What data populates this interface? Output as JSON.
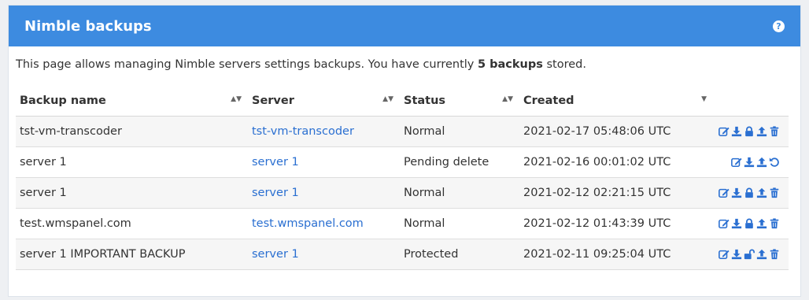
{
  "panel": {
    "title": "Nimble backups",
    "help_glyph": "?"
  },
  "intro": {
    "prefix": "This page allows managing Nimble servers settings backups. You have currently ",
    "count": "5 backups",
    "suffix": " stored."
  },
  "table": {
    "columns": [
      "Backup name",
      "Server",
      "Status",
      "Created"
    ],
    "rows": [
      {
        "name": "tst-vm-transcoder",
        "server": "tst-vm-transcoder",
        "status": "Normal",
        "created": "2021-02-17 05:48:06 UTC",
        "actions": [
          "edit-icon",
          "download-icon",
          "lock-icon",
          "upload-icon",
          "trash-icon"
        ]
      },
      {
        "name": "server 1",
        "server": "server 1",
        "status": "Pending delete",
        "created": "2021-02-16 00:01:02 UTC",
        "actions": [
          "edit-icon",
          "download-icon",
          "upload-icon",
          "undo-icon"
        ]
      },
      {
        "name": "server 1",
        "server": "server 1",
        "status": "Normal",
        "created": "2021-02-12 02:21:15 UTC",
        "actions": [
          "edit-icon",
          "download-icon",
          "lock-icon",
          "upload-icon",
          "trash-icon"
        ]
      },
      {
        "name": "test.wmspanel.com",
        "server": "test.wmspanel.com",
        "status": "Normal",
        "created": "2021-02-12 01:43:39 UTC",
        "actions": [
          "edit-icon",
          "download-icon",
          "lock-icon",
          "upload-icon",
          "trash-icon"
        ]
      },
      {
        "name": "server 1 IMPORTANT BACKUP",
        "server": "server 1",
        "status": "Protected",
        "created": "2021-02-11 09:25:04 UTC",
        "actions": [
          "edit-icon",
          "download-icon",
          "unlock-icon",
          "upload-icon",
          "trash-icon"
        ]
      }
    ]
  },
  "colors": {
    "header": "#3d8be0",
    "link": "#2a6fd1",
    "icon": "#2a6fd1"
  }
}
